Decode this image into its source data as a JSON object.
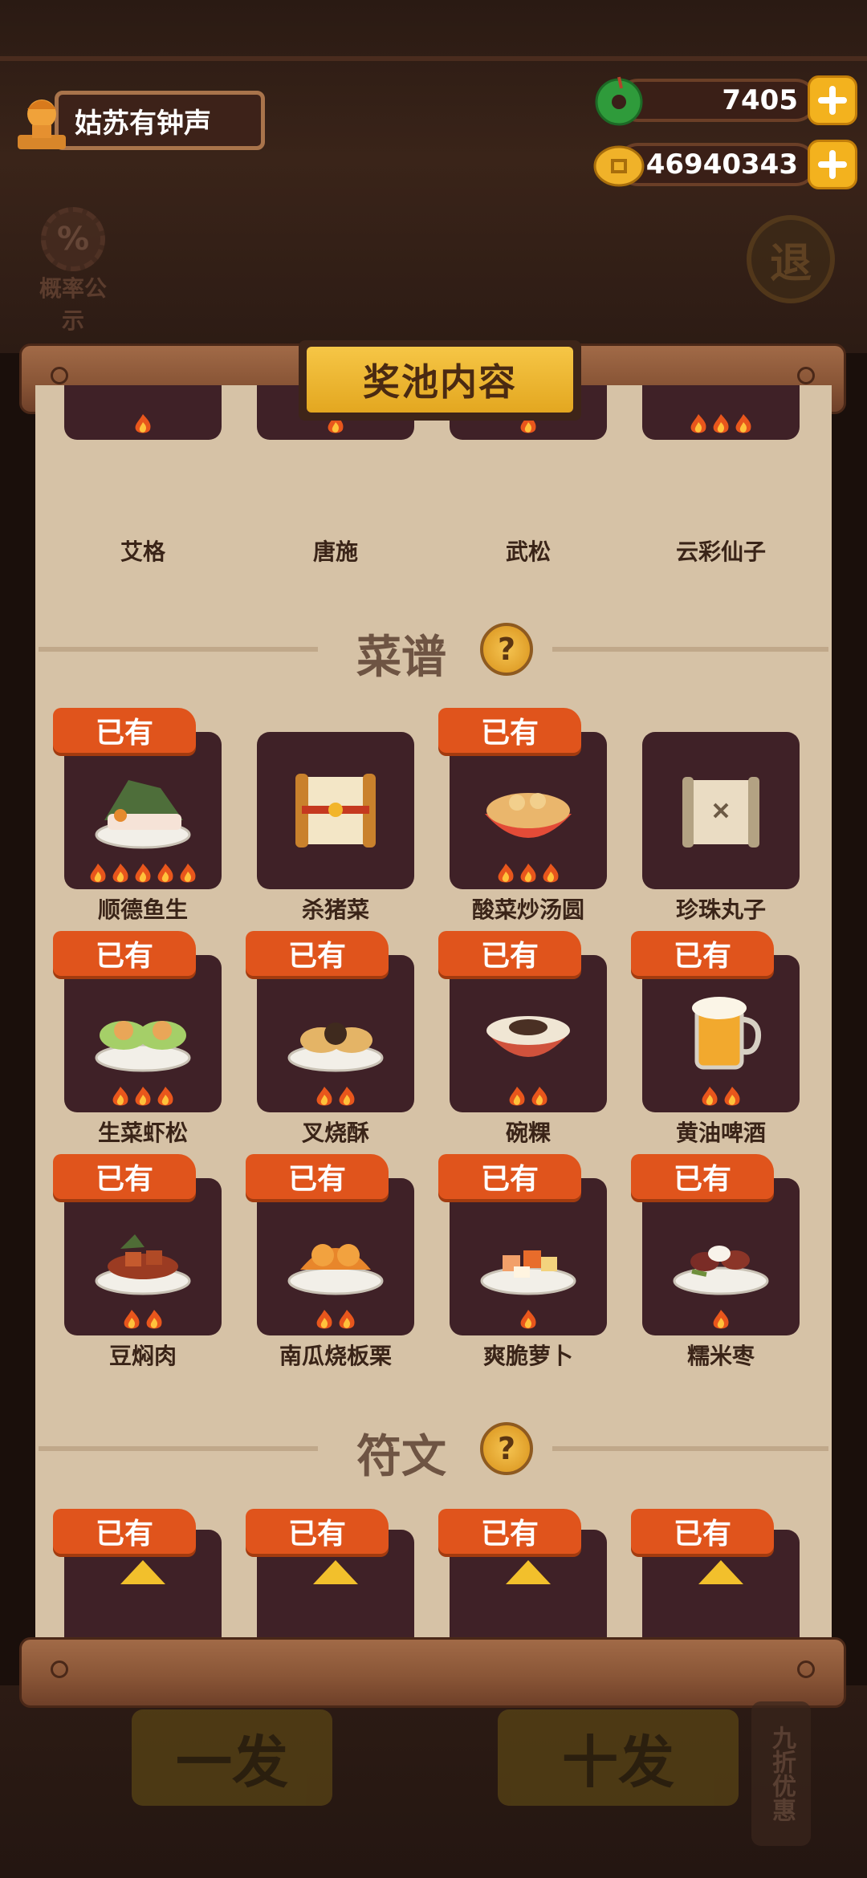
{
  "player": {
    "name": "姑苏有钟声"
  },
  "currencies": [
    {
      "name": "jade",
      "value": "7405",
      "color": "#2f9b3b"
    },
    {
      "name": "coin",
      "value": "46940343",
      "color": "#f0b229"
    }
  ],
  "side_buttons": {
    "probability": "概率公示",
    "exit": "退"
  },
  "panel": {
    "title": "奖池内容",
    "characters": [
      {
        "name": "艾格",
        "flames": 1
      },
      {
        "name": "唐施",
        "flames": 1
      },
      {
        "name": "武松",
        "flames": 1
      },
      {
        "name": "云彩仙子",
        "flames": 3
      }
    ],
    "recipes_section": {
      "title": "菜谱",
      "help": "?"
    },
    "recipes": [
      {
        "name": "顺德鱼生",
        "owned": true,
        "flames": 5,
        "icon": "fish-sashimi"
      },
      {
        "name": "杀猪菜",
        "owned": false,
        "flames": 0,
        "icon": "scroll-gold"
      },
      {
        "name": "酸菜炒汤圆",
        "owned": true,
        "flames": 3,
        "icon": "tangyuan-bowl"
      },
      {
        "name": "珍珠丸子",
        "owned": false,
        "flames": 0,
        "icon": "scroll-plain"
      },
      {
        "name": "生菜虾松",
        "owned": true,
        "flames": 3,
        "icon": "lettuce-shrimp"
      },
      {
        "name": "叉烧酥",
        "owned": true,
        "flames": 2,
        "icon": "char-siu-pastry"
      },
      {
        "name": "碗粿",
        "owned": true,
        "flames": 2,
        "icon": "rice-cake-bowl"
      },
      {
        "name": "黄油啤酒",
        "owned": true,
        "flames": 2,
        "icon": "beer-mug"
      },
      {
        "name": "豆焖肉",
        "owned": true,
        "flames": 2,
        "icon": "braised-pork"
      },
      {
        "name": "南瓜烧板栗",
        "owned": true,
        "flames": 2,
        "icon": "pumpkin-chestnut"
      },
      {
        "name": "爽脆萝卜",
        "owned": true,
        "flames": 1,
        "icon": "crispy-radish"
      },
      {
        "name": "糯米枣",
        "owned": true,
        "flames": 1,
        "icon": "sticky-rice-dates"
      }
    ],
    "owned_label": "已有",
    "runes_section": {
      "title": "符文",
      "help": "?"
    },
    "runes": [
      {
        "owned": true
      },
      {
        "owned": true
      },
      {
        "owned": true
      },
      {
        "owned": true
      }
    ]
  },
  "bottom_buttons": {
    "single": "一发",
    "ten": "十发",
    "discount": "九折优惠"
  }
}
